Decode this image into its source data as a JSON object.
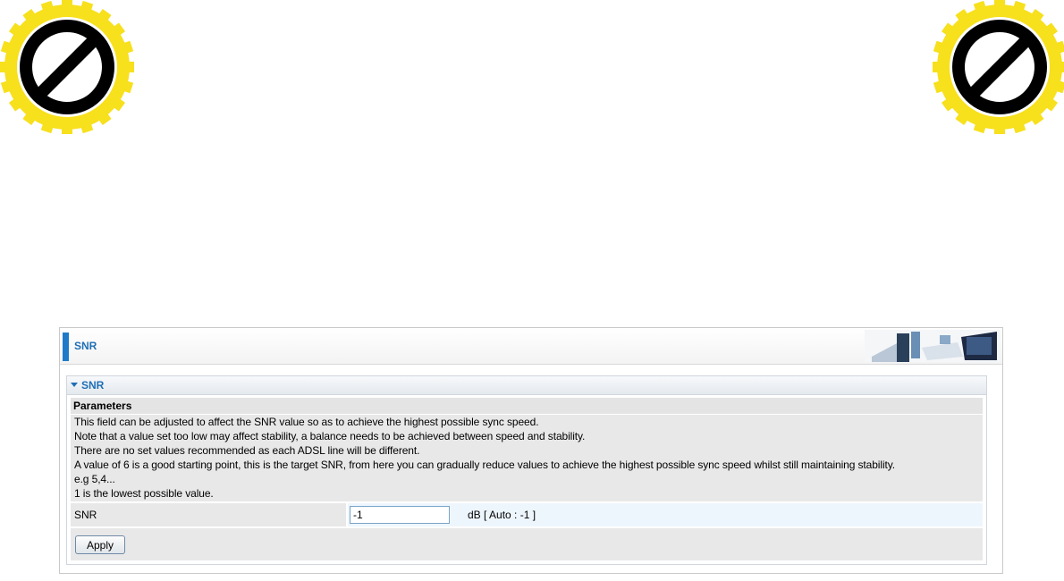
{
  "header": {
    "title": "SNR"
  },
  "section": {
    "title": "SNR",
    "params_heading": "Parameters",
    "params_lines": [
      "This field can be adjusted to affect the SNR value so as to achieve the highest possible sync speed.",
      "Note that a value set too low may affect stability, a balance needs to be achieved between speed and stability.",
      "There are no set values recommended as each ADSL line will be different.",
      "A value of 6 is a good starting point, this is the target SNR, from here you can gradually reduce values to achieve the highest possible sync speed whilst still maintaining stability.",
      "e.g 5,4...",
      "1 is the lowest possible value."
    ],
    "snr_label": "SNR",
    "snr_value": "-1",
    "snr_hint": "dB [ Auto : -1 ]",
    "apply_label": "Apply"
  },
  "icons": {
    "badges": [
      "prohibited-icon",
      "prohibited-icon"
    ],
    "caret": "caret-down-icon"
  },
  "colors": {
    "accent": "#1f7bc8",
    "badge_yellow": "#f7e01c",
    "badge_black": "#000000"
  }
}
